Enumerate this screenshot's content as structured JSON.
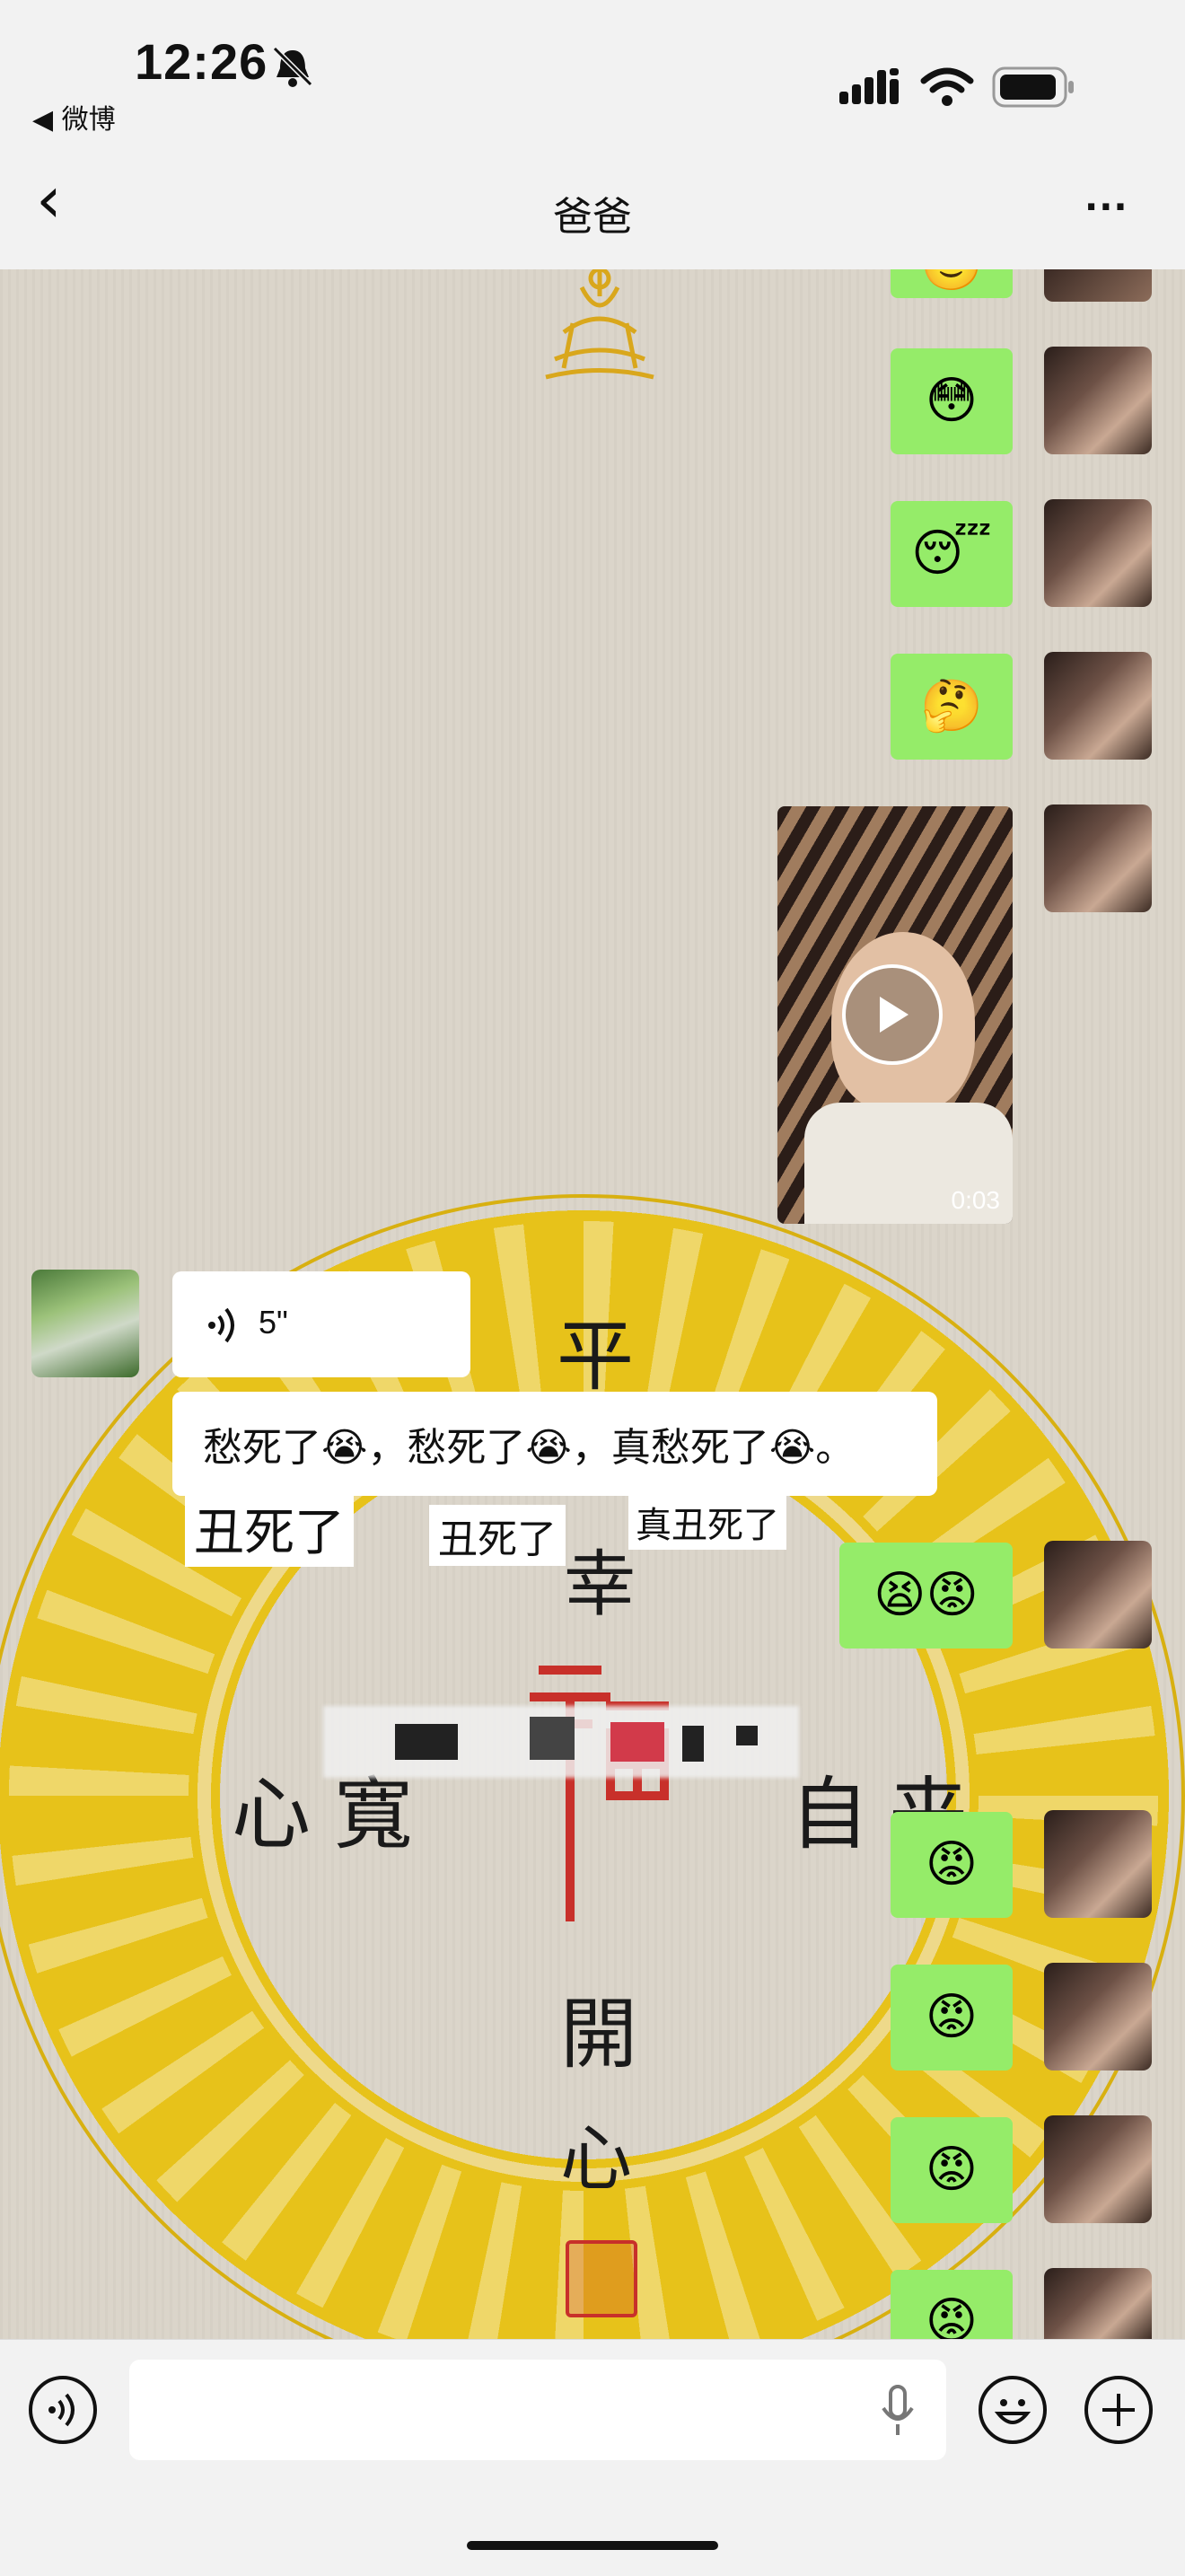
{
  "status": {
    "time": "12:26",
    "back_app": "◀ 微博"
  },
  "nav": {
    "back_icon": "‹",
    "title": "爸爸",
    "more_icon": "···"
  },
  "background": {
    "chars": [
      "平",
      "幸",
      "心",
      "寬",
      "自",
      "来",
      "開",
      "心"
    ]
  },
  "messages": {
    "voice_duration": "5\"",
    "text_msg": "愁死了😭，愁死了😭，真愁死了😭。",
    "video_duration": "0:03",
    "sticker1": "丑死了",
    "sticker2": "丑死了",
    "sticker3": "真丑死了",
    "emoji_top": "🙂",
    "emoji_flushed": "😳",
    "emoji_sleep": "😴",
    "emoji_think": "🤔",
    "emoji_angry_pair": "😫😡",
    "emoji_angry": "😡"
  },
  "colors": {
    "green_bubble": "#95ec69",
    "seal_red": "#c8302a",
    "ring_yellow": "#e7c21a"
  }
}
